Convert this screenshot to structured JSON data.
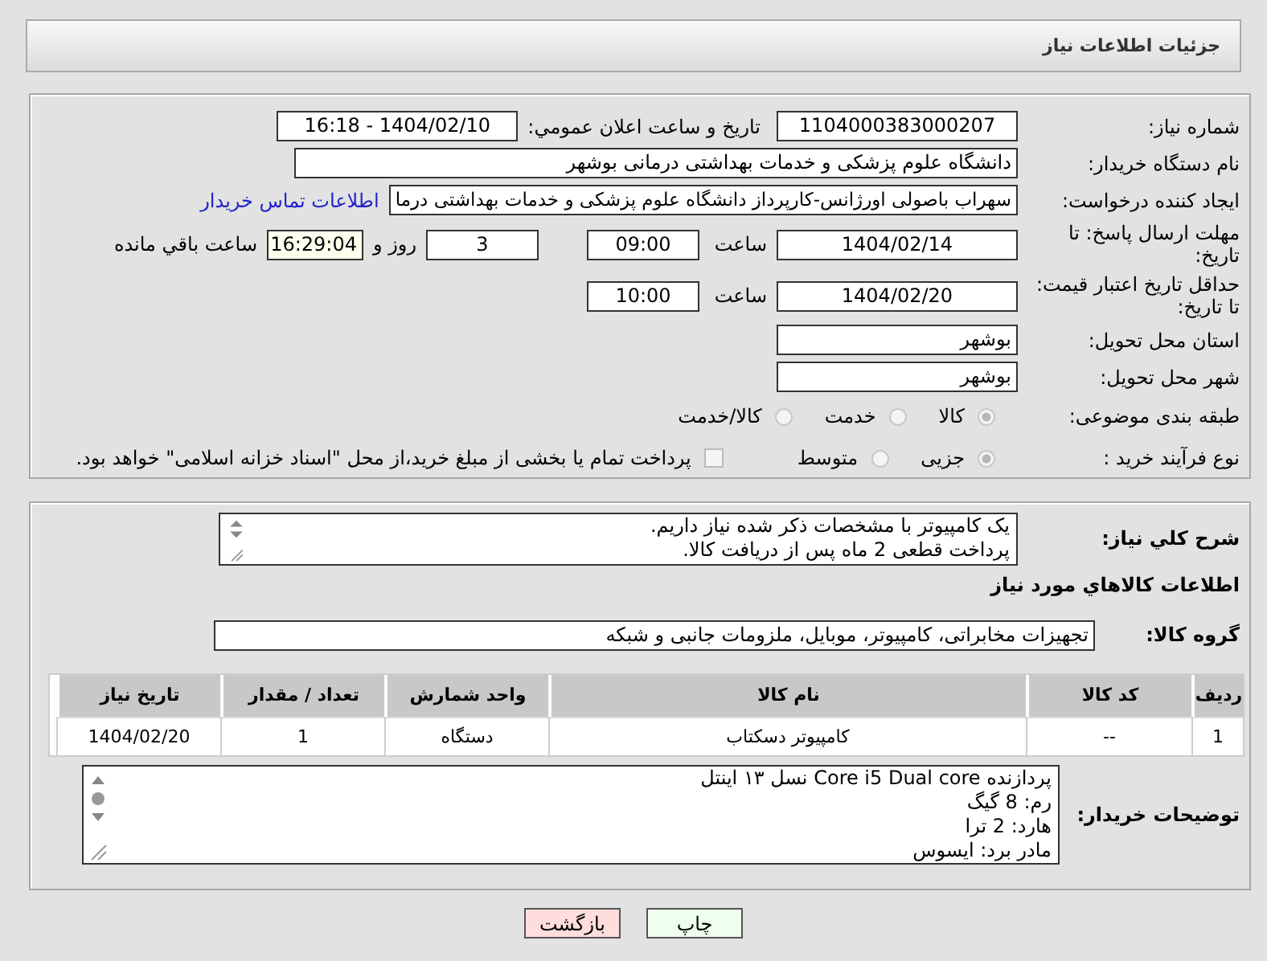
{
  "header": {
    "title": "جزئیات اطلاعات نیاز"
  },
  "need_number": {
    "label": "شماره نیاز:",
    "value": "1104000383000207"
  },
  "announce": {
    "label": "تاریخ و ساعت اعلان عمومي:",
    "value": "1404/02/10 - 16:18"
  },
  "buyer_org": {
    "label": "نام دستگاه خریدار:",
    "value": "دانشگاه علوم پزشکی و خدمات بهداشتی درمانی بوشهر"
  },
  "requester": {
    "label": "ایجاد کننده درخواست:",
    "value": "سهراب باصولی اورژانس-کارپرداز دانشگاه علوم پزشکی و خدمات بهداشتی درما",
    "link": "اطلاعات تماس خریدار"
  },
  "reply_deadline": {
    "label": "مهلت ارسال پاسخ: تا تاریخ:",
    "date": "1404/02/14",
    "time_label": "ساعت",
    "time": "09:00",
    "days": "3",
    "days_label": "روز و",
    "remaining": "16:29:04",
    "remaining_label": "ساعت باقي مانده"
  },
  "price_validity": {
    "label": "حداقل تاریخ اعتبار قیمت: تا تاریخ:",
    "date": "1404/02/20",
    "time_label": "ساعت",
    "time": "10:00"
  },
  "province": {
    "label": "استان محل تحویل:",
    "value": "بوشهر"
  },
  "city": {
    "label": "شهر محل تحویل:",
    "value": "بوشهر"
  },
  "category": {
    "label": "طبقه بندی موضوعی:",
    "options": [
      {
        "label": "کالا",
        "selected": true
      },
      {
        "label": "خدمت",
        "selected": false
      },
      {
        "label": "کالا/خدمت",
        "selected": false
      }
    ]
  },
  "process": {
    "label": "نوع فرآیند خرید :",
    "options": [
      {
        "label": "جزیی",
        "selected": true
      },
      {
        "label": "متوسط",
        "selected": false
      }
    ],
    "treasury": {
      "label": "پرداخت تمام یا بخشی از مبلغ خرید،از محل \"اسناد خزانه اسلامی\" خواهد بود.",
      "checked": false
    }
  },
  "description": {
    "label": "شرح کلي نياز:",
    "lines": [
      "یک کامپیوتر با مشخصات ذکر شده نیاز داریم.",
      "پرداخت قطعی 2 ماه پس از دریافت کالا."
    ]
  },
  "goods_title": "اطلاعات کالاهاي مورد نياز",
  "goods_group": {
    "label": "گروه کالا:",
    "value": "تجهیزات مخابراتی، کامپیوتر، موبایل، ملزومات جانبی و شبکه"
  },
  "table": {
    "columns": [
      "ردیف",
      "کد کالا",
      "نام کالا",
      "واحد شمارش",
      "تعداد / مقدار",
      "تاریخ نیاز"
    ],
    "rows": [
      [
        "1",
        "--",
        "کامپیوتر دسکتاب",
        "دستگاه",
        "1",
        "1404/02/20"
      ]
    ]
  },
  "buyer_notes": {
    "label": "توضیحات خریدار:",
    "lines": [
      "پردازنده Core i5 Dual core نسل ۱۳ اینتل",
      "رم: 8 گیگ",
      "هارد: 2 ترا",
      "مادر برد: ایسوس"
    ]
  },
  "buttons": [
    {
      "label": "چاپ",
      "kind": "print"
    },
    {
      "label": "بازگشت",
      "kind": "back"
    }
  ]
}
